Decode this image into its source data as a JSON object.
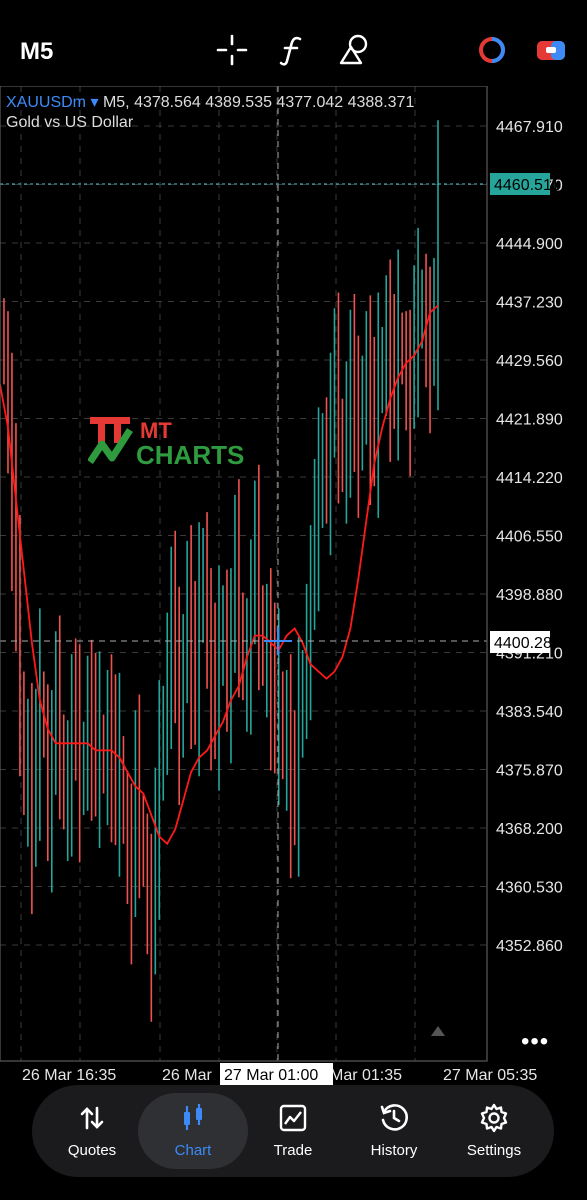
{
  "toolbar": {
    "timeframe": "M5",
    "icons": [
      "crosshair-icon",
      "function-icon",
      "objects-icon",
      "accounts-icon",
      "one-click-trading-icon"
    ]
  },
  "chart": {
    "symbol": "XAUUSDm",
    "dropdown_glyph": "▾",
    "ohlc_text": "M5, 4378.564 4389.535 4377.042 4388.371",
    "description": "Gold vs US Dollar",
    "price_labels": [
      "4467.910",
      "4452.570",
      "4444.900",
      "4437.230",
      "4429.560",
      "4421.890",
      "4414.220",
      "4406.550",
      "4398.880",
      "4391.210",
      "4383.540",
      "4375.870",
      "4368.200",
      "4360.530",
      "4352.860"
    ],
    "bid_label": "4460.511",
    "crosshair_price": "4400.287",
    "time_labels": [
      "26 Mar 16:35",
      "26 Mar",
      "Mar 01:35",
      "27 Mar 05:35"
    ],
    "crosshair_time": "27 Mar 01:00",
    "more_glyph": "•••",
    "colors": {
      "bull": "#26a69a",
      "bear": "#ef5350",
      "ma": "#ff1a1a",
      "bid_line": "#4fc3d6",
      "grid": "#3a3a3a"
    }
  },
  "watermark": {
    "line1": "MT",
    "line2": "CHARTS"
  },
  "chart_data": {
    "type": "candlestick",
    "title": "XAUUSDm, M5",
    "y_range": [
      4348,
      4472
    ],
    "closes": [
      4440,
      4432,
      4420,
      4405,
      4392,
      4380,
      4386,
      4375,
      4383,
      4392,
      4388,
      4378,
      4385,
      4391,
      4386,
      4378,
      4383,
      4390,
      4387,
      4380,
      4385,
      4392,
      4388,
      4382,
      4386,
      4383,
      4390,
      4385,
      4378,
      4383,
      4376,
      4372,
      4368,
      4380,
      4375,
      4370,
      4365,
      4360,
      4372,
      4382,
      4390,
      4398,
      4405,
      4395,
      4388,
      4400,
      4408,
      4398,
      4392,
      4404,
      4412,
      4402,
      4395,
      4390,
      4398,
      4404,
      4396,
      4402,
      4410,
      4403,
      4396,
      4400,
      4406,
      4412,
      4404,
      4398,
      4402,
      4395,
      4388,
      4392,
      4385,
      4390,
      4380,
      4378,
      4388,
      4395,
      4402,
      4408,
      4415,
      4420,
      4428,
      4425,
      4432,
      4436,
      4430,
      4425,
      4433,
      4438,
      4430,
      4428,
      4436,
      4440,
      4432,
      4428,
      4436,
      4440,
      4445,
      4438,
      4436,
      4442,
      4440,
      4438,
      4436,
      4442,
      4445,
      4448,
      4444,
      4442,
      4443,
      4460
    ],
    "ma_series": [
      4436,
      4430,
      4420,
      4410,
      4400,
      4392,
      4388,
      4386,
      4386,
      4386,
      4386,
      4386,
      4385,
      4385,
      4385,
      4384,
      4382,
      4380,
      4379,
      4376,
      4373,
      4372,
      4374,
      4378,
      4382,
      4384,
      4385,
      4387,
      4389,
      4392,
      4394,
      4398,
      4401,
      4401,
      4400,
      4399,
      4401,
      4402,
      4400,
      4397,
      4396,
      4395,
      4396,
      4398,
      4402,
      4409,
      4417,
      4425,
      4430,
      4434,
      4437,
      4439,
      4440,
      4442,
      4446,
      4447
    ]
  }
}
